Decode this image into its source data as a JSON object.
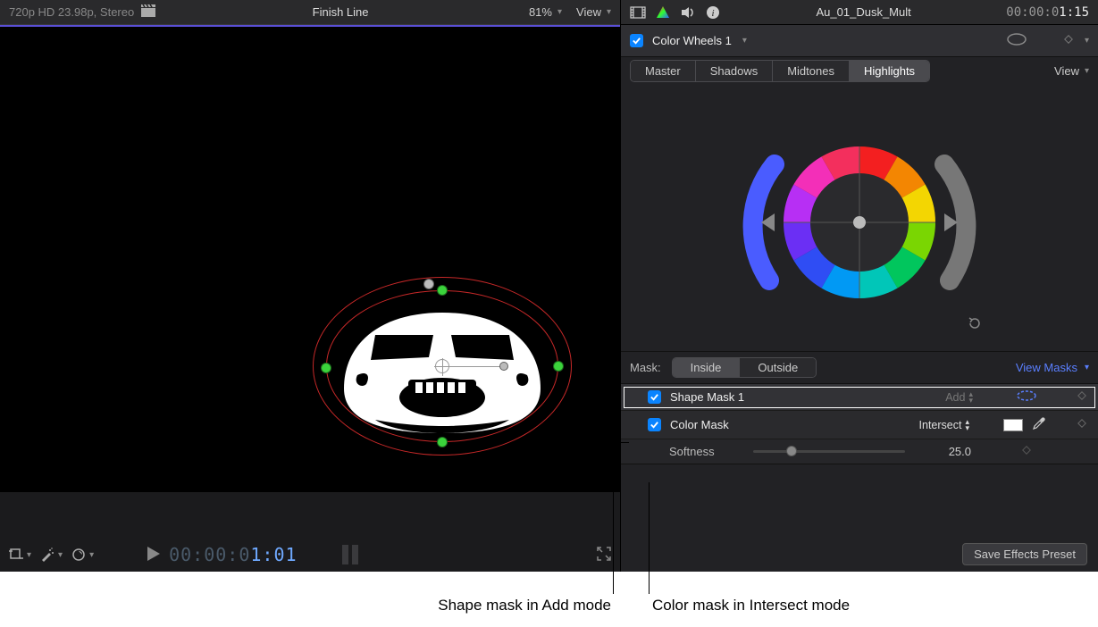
{
  "viewer": {
    "format": "720p HD 23.98p, Stereo",
    "title": "Finish Line",
    "zoom": "81%",
    "view_label": "View"
  },
  "transport": {
    "timecode_dim": "00:00:0",
    "timecode_bright": "1:01"
  },
  "inspector": {
    "clip_name": "Au_01_Dusk_Mult",
    "tc_dim": "00:00:0",
    "tc_bright": "1:15",
    "effect_name": "Color Wheels 1",
    "wheel_tabs": [
      "Master",
      "Shadows",
      "Midtones",
      "Highlights"
    ],
    "active_tab": 3,
    "view_label": "View",
    "mask_label": "Mask:",
    "mask_seg": [
      "Inside",
      "Outside"
    ],
    "mask_active": 0,
    "view_masks": "View Masks",
    "masks": [
      {
        "name": "Shape Mask 1",
        "mode": "Add",
        "type": "shape"
      },
      {
        "name": "Color Mask",
        "mode": "Intersect",
        "type": "color"
      }
    ],
    "softness_label": "Softness",
    "softness_value": "25.0",
    "save_preset": "Save Effects Preset"
  },
  "annotations": {
    "left": "Shape mask in Add mode",
    "right": "Color mask in Intersect mode"
  }
}
